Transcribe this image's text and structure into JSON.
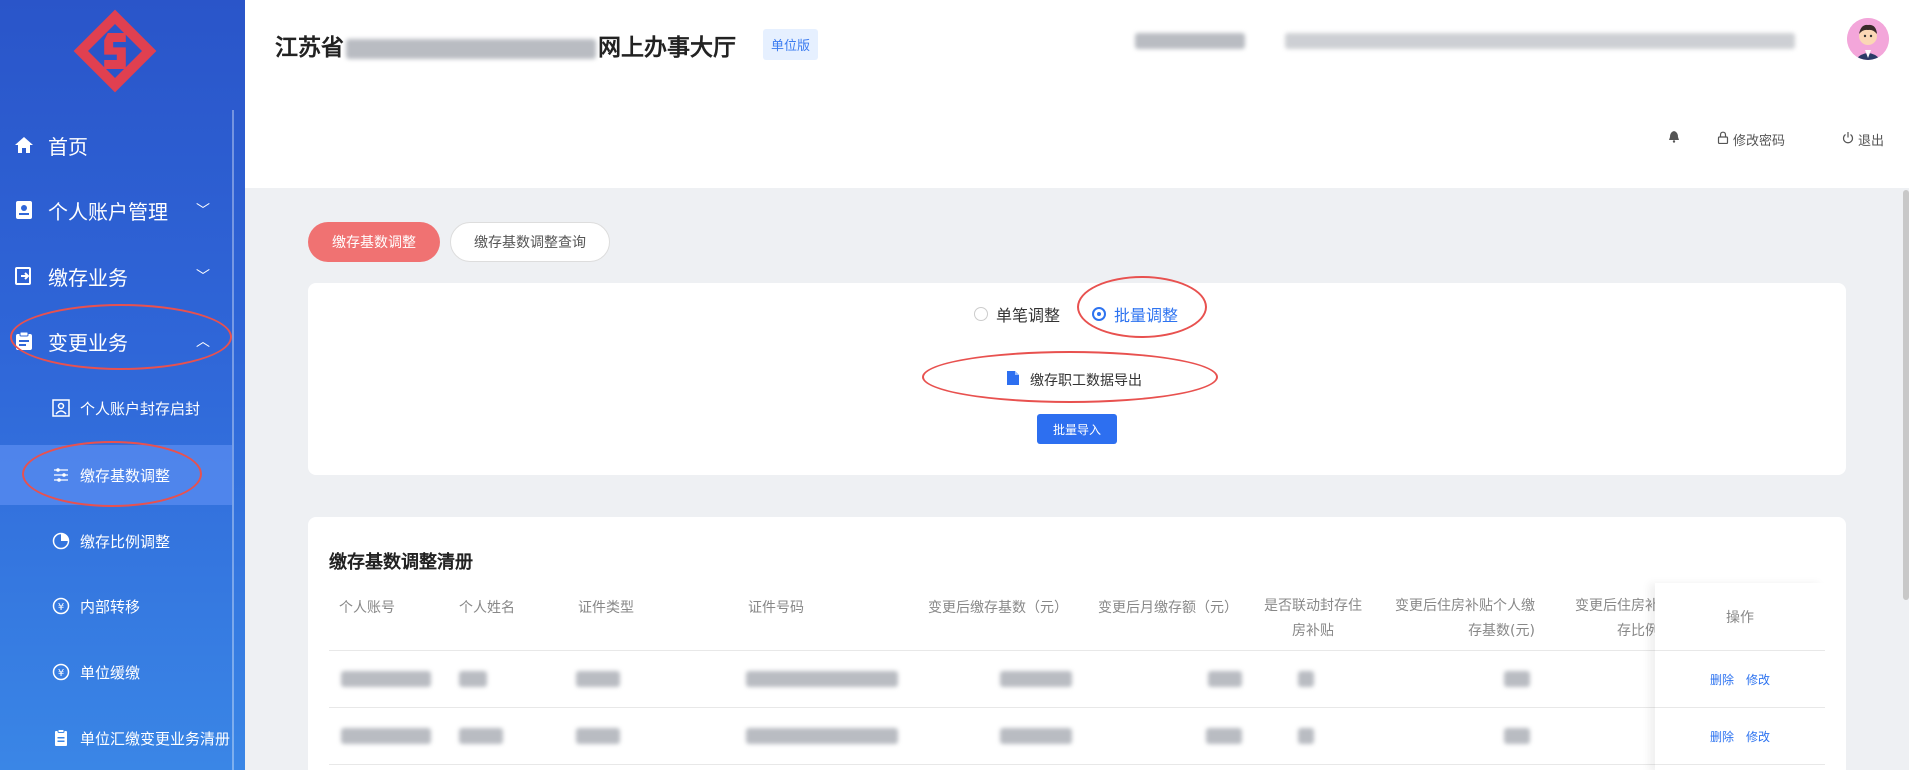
{
  "sidebar": {
    "items": [
      {
        "label": "首页",
        "icon": "home-icon"
      },
      {
        "label": "个人账户管理",
        "icon": "id-card-icon"
      },
      {
        "label": "缴存业务",
        "icon": "deposit-icon"
      },
      {
        "label": "变更业务",
        "icon": "clipboard-icon"
      }
    ],
    "subitems": [
      {
        "label": "个人账户封存启封",
        "icon": "account-lock-icon"
      },
      {
        "label": "缴存基数调整",
        "icon": "sliders-icon"
      },
      {
        "label": "缴存比例调整",
        "icon": "pie-chart-icon"
      },
      {
        "label": "内部转移",
        "icon": "yuan-transfer-icon"
      },
      {
        "label": "单位缓缴",
        "icon": "yuan-defer-icon"
      },
      {
        "label": "单位汇缴变更业务清册",
        "icon": "document-icon"
      }
    ]
  },
  "header": {
    "title_start": "江苏省",
    "title_end": "网上办事大厅",
    "badge": "单位版",
    "links": {
      "change_password": "修改密码",
      "logout": "退出"
    }
  },
  "tabs": [
    {
      "label": "缴存基数调整"
    },
    {
      "label": "缴存基数调整查询"
    }
  ],
  "adjust": {
    "single_label": "单笔调整",
    "batch_label": "批量调整",
    "export_label": "缴存职工数据导出",
    "import_button": "批量导入"
  },
  "list": {
    "title": "缴存基数调整清册",
    "columns": [
      "个人账号",
      "个人姓名",
      "证件类型",
      "证件号码",
      "变更后缴存基数（元）",
      "变更后月缴存额（元）",
      "是否联动封存住\n房补贴",
      "变更后住房补贴个人缴\n存基数(元)",
      "变更后住房补\n存比例",
      "操作"
    ],
    "actions": {
      "delete": "删除",
      "edit": "修改"
    }
  },
  "colors": {
    "accent": "#2d6ff0",
    "tab_active": "#f07272",
    "annotation": "#e8514f"
  }
}
